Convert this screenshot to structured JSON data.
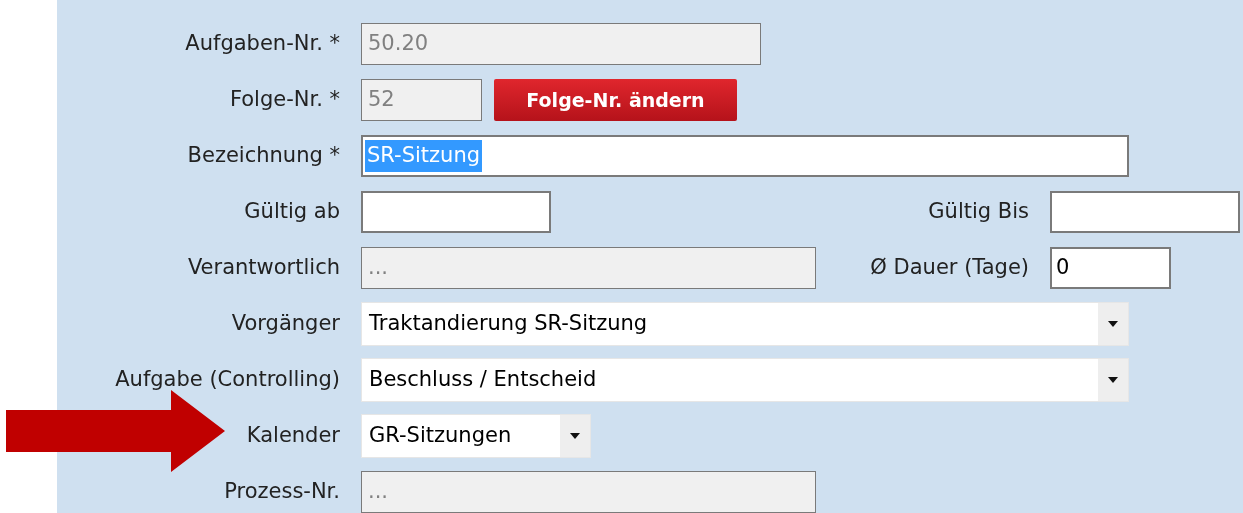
{
  "form": {
    "rows": [
      {
        "label": "Aufgaben-Nr. *",
        "field": {
          "kind": "readonly",
          "value": "50.20"
        }
      },
      {
        "label": "Folge-Nr. *",
        "field": {
          "kind": "readonly",
          "value": "52"
        },
        "button": {
          "label": "Folge-Nr. ändern"
        }
      },
      {
        "label": "Bezeichnung *",
        "field": {
          "kind": "text",
          "value": "SR-Sitzung",
          "selected": true
        }
      },
      {
        "label": "Gültig ab",
        "field": {
          "kind": "text"
        },
        "extra": {
          "label": "Gültig Bis",
          "field": {
            "kind": "text"
          }
        }
      },
      {
        "label": "Verantwortlich",
        "field": {
          "kind": "readonly",
          "value": "..."
        },
        "extra": {
          "label": "Ø Dauer (Tage)",
          "field": {
            "kind": "text",
            "value": "0",
            "selected": false
          }
        }
      },
      {
        "label": "Vorgänger",
        "field": {
          "kind": "select",
          "value": "Traktandierung SR-Sitzung"
        }
      },
      {
        "label": "Aufgabe (Controlling)",
        "field": {
          "kind": "select",
          "value": "Beschluss / Entscheid"
        }
      },
      {
        "label": "Kalender",
        "field": {
          "kind": "select",
          "value": "GR-Sitzungen"
        }
      },
      {
        "label": "Prozess-Nr.",
        "field": {
          "kind": "readonly",
          "value": "..."
        }
      }
    ]
  }
}
